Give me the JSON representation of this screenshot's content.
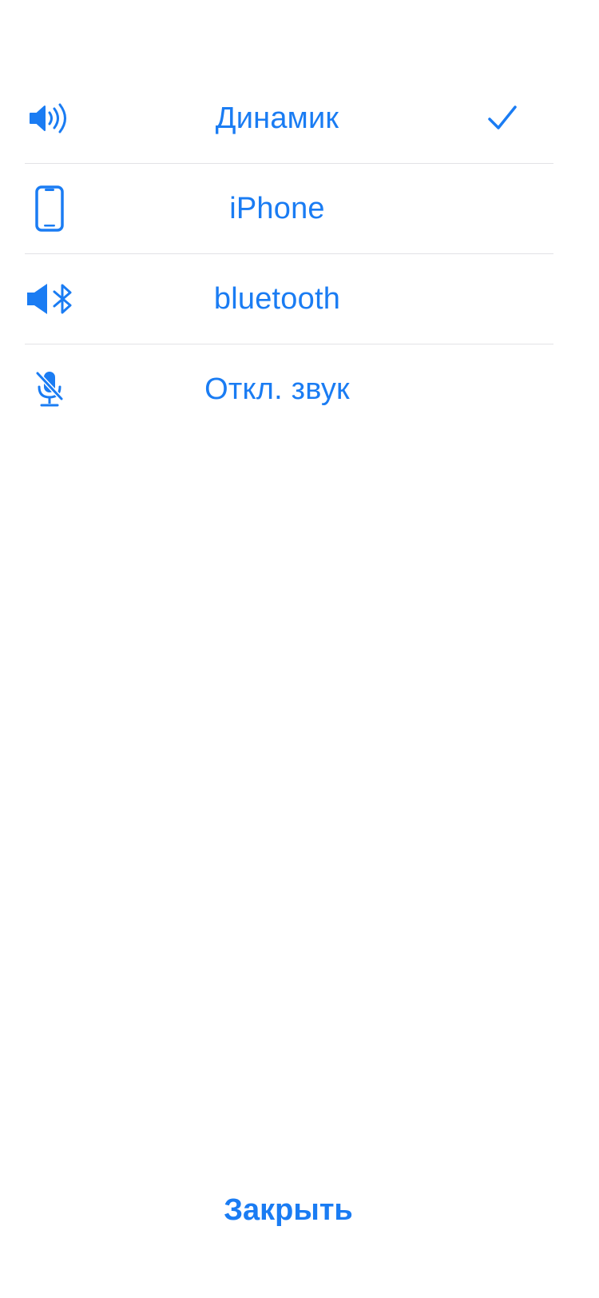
{
  "accent_color": "#1a7cf3",
  "audio_routes": [
    {
      "label": "Динамик",
      "icon": "speaker-wave-icon",
      "selected": true
    },
    {
      "label": "iPhone",
      "icon": "iphone-icon",
      "selected": false
    },
    {
      "label": "bluetooth",
      "icon": "speaker-bluetooth-icon",
      "selected": false
    },
    {
      "label": "Откл. звук",
      "icon": "mic-slash-icon",
      "selected": false
    }
  ],
  "close_label": "Закрыть"
}
